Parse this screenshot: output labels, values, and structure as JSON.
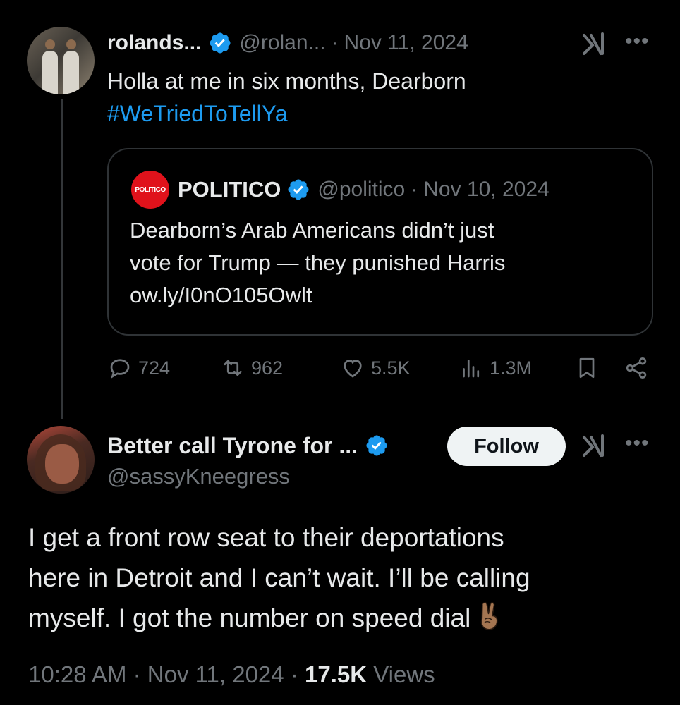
{
  "tweet1": {
    "display_name": "rolands...",
    "handle": "@rolan...",
    "separator": "·",
    "date": "Nov 11, 2024",
    "text_line1": "Holla at me in six months, Dearborn",
    "hashtag": "#WeTriedToTellYa",
    "quote": {
      "logo_text": "POLITICO",
      "display_name": "POLITICO",
      "handle": "@politico",
      "separator": "·",
      "date": "Nov 10, 2024",
      "text_line1": "Dearborn’s Arab Americans didn’t just",
      "text_line2": "vote for Trump — they punished Harris",
      "link": "ow.ly/I0nO105Owlt"
    },
    "actions": {
      "replies": "724",
      "reposts": "962",
      "likes": "5.5K",
      "views": "1.3M"
    }
  },
  "tweet2": {
    "display_name": "Better call Tyrone for ...",
    "handle": "@sassyKneegress",
    "follow_label": "Follow",
    "text_line1": "I get a front row seat to their deportations",
    "text_line2": "here in Detroit and I can’t wait. I’ll be calling",
    "text_line3": "myself. I got the number on speed dial",
    "emoji": "victory-hand-medium-skin-tone",
    "time": "10:28 AM",
    "separator": "·",
    "date": "Nov 11, 2024",
    "views_count": "17.5K",
    "views_label": "Views"
  },
  "colors": {
    "background": "#000000",
    "text_primary": "#e7e9ea",
    "text_secondary": "#71767b",
    "accent": "#1d9bf0",
    "border": "#2f3336",
    "politico_red": "#e0121b"
  }
}
